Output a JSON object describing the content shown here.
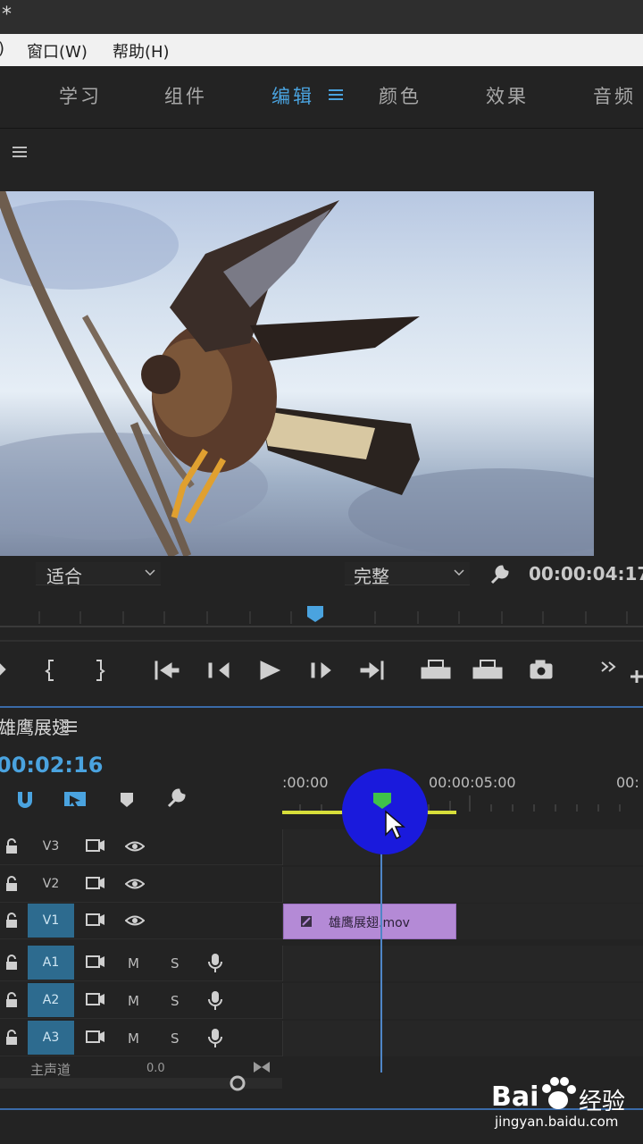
{
  "titlebar": {
    "title": "*"
  },
  "menu": {
    "window": "窗口(W)",
    "help": "帮助(H)",
    "prev_fragment": ")"
  },
  "workspaces": {
    "learn": "学习",
    "assembly": "组件",
    "editing": "编辑",
    "color": "颜色",
    "effects": "效果",
    "audio": "音频"
  },
  "monitor": {
    "fit_value": "适合",
    "quality_value": "完整",
    "timecode": "00:00:04:17"
  },
  "timeline": {
    "sequence_name": "雄鹰展翅",
    "current_timecode": "00:02:16",
    "ruler_start": ":00:00",
    "ruler_mid": "00:00:05:00",
    "ruler_end": "00:",
    "tracks": {
      "v3": "V3",
      "v2": "V2",
      "v1": "V1",
      "a1": "A1",
      "a2": "A2",
      "a3": "A3",
      "mute": "M",
      "solo": "S"
    },
    "clip_name": "雄鹰展翅.mov",
    "master_label": "主声道",
    "master_value": "0.0"
  },
  "watermark": {
    "brand": "Bai",
    "brand_cn": "经验",
    "url": "jingyan.baidu.com"
  },
  "colors": {
    "accent": "#4aa3df",
    "clip": "#b48ad6",
    "target_track": "#2d6b8f",
    "click_marker": "#1a1adc",
    "playhead": "#4f86c7"
  }
}
